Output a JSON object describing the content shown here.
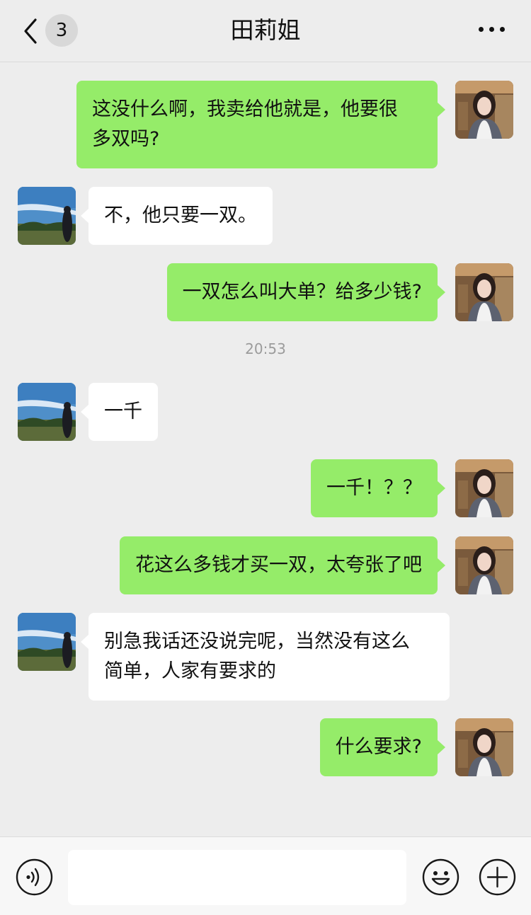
{
  "header": {
    "back_badge": "3",
    "title": "田莉姐"
  },
  "colors": {
    "self_bubble": "#95ec69",
    "other_bubble": "#ffffff",
    "background": "#ededed"
  },
  "messages": [
    {
      "side": "right",
      "text_lines": [
        "这没什么啊，我卖给他就是，他要很",
        "多双吗?"
      ]
    },
    {
      "side": "left",
      "text_lines": [
        "不，他只要一双。"
      ]
    },
    {
      "side": "right",
      "text_lines": [
        "一双怎么叫大单？给多少钱?"
      ]
    },
    {
      "timestamp": "20:53"
    },
    {
      "side": "left",
      "text_lines": [
        "一千"
      ]
    },
    {
      "side": "right",
      "text_lines": [
        "一千！？？"
      ]
    },
    {
      "side": "right",
      "text_lines": [
        "花这么多钱才买一双，太夸张了吧"
      ]
    },
    {
      "side": "left",
      "text_lines": [
        "别急我话还没说完呢，当然没有这么",
        "简单，人家有要求的"
      ]
    },
    {
      "side": "right",
      "text_lines": [
        "什么要求?"
      ]
    }
  ],
  "icons": {
    "back": "chevron-left-icon",
    "more": "more-icon",
    "voice": "voice-icon",
    "emoji": "emoji-icon",
    "plus": "plus-icon"
  }
}
